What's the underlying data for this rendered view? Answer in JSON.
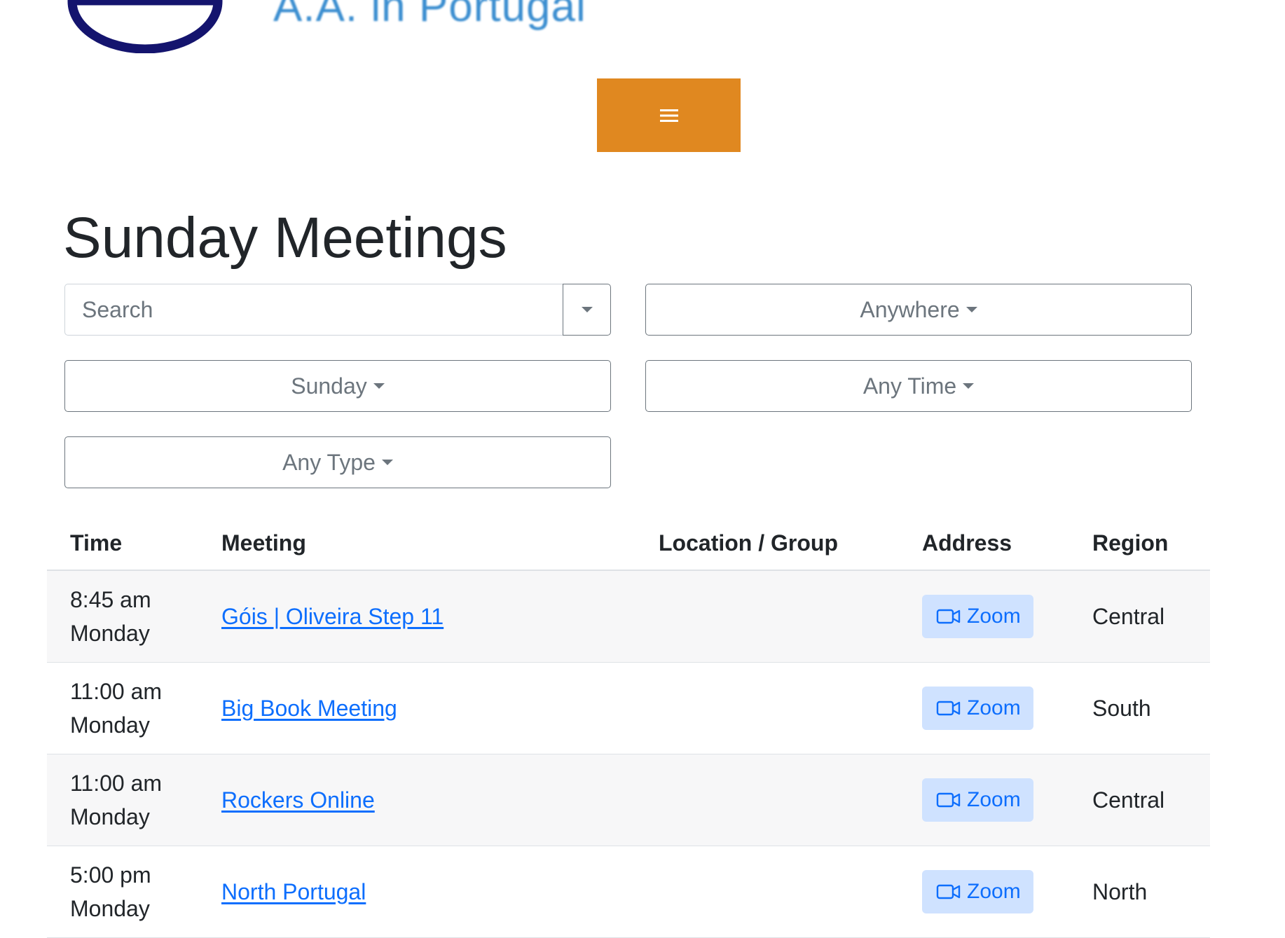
{
  "header": {
    "site_title": "A.A. in Portugal",
    "menu_icon": "hamburger-icon",
    "brand_color": "#e08820"
  },
  "page": {
    "title": "Sunday Meetings"
  },
  "filters": {
    "search_placeholder": "Search",
    "region": "Anywhere",
    "day": "Sunday",
    "time": "Any Time",
    "type": "Any Type"
  },
  "table": {
    "headers": {
      "time": "Time",
      "meeting": "Meeting",
      "location": "Location / Group",
      "address": "Address",
      "region": "Region"
    },
    "rows": [
      {
        "time": "8:45 am",
        "day": "Monday",
        "meeting": "Góis | Oliveira Step 11",
        "location": "",
        "address": "Zoom",
        "region": "Central"
      },
      {
        "time": "11:00 am",
        "day": "Monday",
        "meeting": "Big Book Meeting",
        "location": "",
        "address": "Zoom",
        "region": "South"
      },
      {
        "time": "11:00 am",
        "day": "Monday",
        "meeting": "Rockers Online",
        "location": "",
        "address": "Zoom",
        "region": "Central"
      },
      {
        "time": "5:00 pm",
        "day": "Monday",
        "meeting": "North Portugal",
        "location": "",
        "address": "Zoom",
        "region": "North"
      }
    ]
  },
  "colors": {
    "link": "#0d6efd",
    "zoom_bg": "#cfe2ff",
    "stripe": "#f7f7f8"
  }
}
